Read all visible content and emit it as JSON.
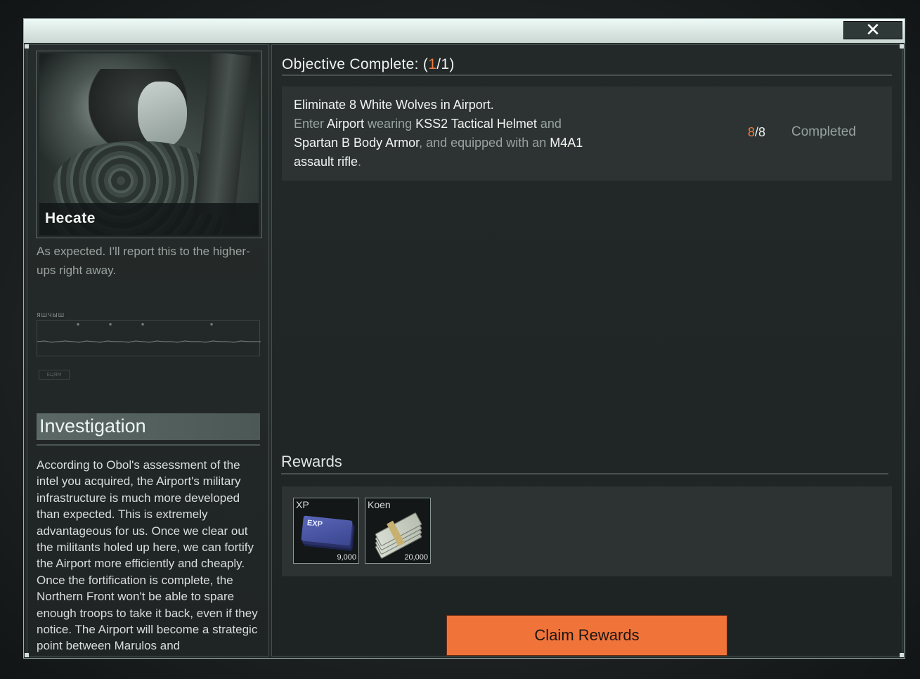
{
  "window": {
    "close_symbol": "✕"
  },
  "character": {
    "name": "Hecate",
    "quote": "As expected. I'll report this to the higher-ups right away."
  },
  "signal": {
    "label": "ЯШЧЫШ",
    "badge": "ЕЦЯМ"
  },
  "mission": {
    "title": "Investigation",
    "description": "According to Obol's assessment of the intel you acquired, the Airport's military infrastructure is much more developed than expected. This is extremely advantageous for us. Once we clear out the militants holed up here, we can fortify the Airport more efficiently and cheaply. Once the fortification is complete, the Northern Front won't be able to spare enough troops to take it back, even if they notice. The Airport will become a strategic point between Marulos and"
  },
  "objective": {
    "header_prefix": "Objective Complete: (",
    "header_done": "1",
    "header_suffix": "/1)",
    "line1_a": "Eliminate 8 ",
    "line1_b": "White Wolves",
    "line1_c": " in ",
    "line1_d": "Airport",
    "line1_e": ".",
    "line2_a": "Enter ",
    "line2_b": "Airport",
    "line2_c": " wearing ",
    "line2_d": "KSS2 Tactical Helmet",
    "line2_e": " and",
    "line3_a": "Spartan B Body Armor",
    "line3_b": ", and equipped with an ",
    "line3_c": "M4A1",
    "line4_a": "assault rifle",
    "line4_b": ".",
    "progress_current": "8",
    "progress_total": "/8",
    "status": "Completed"
  },
  "rewards": {
    "title": "Rewards",
    "items": [
      {
        "label": "XP",
        "quantity": "9,000",
        "icon": "exp-ticket-icon",
        "art_text": "EXP"
      },
      {
        "label": "Koen",
        "quantity": "20,000",
        "icon": "cash-stack-icon"
      }
    ],
    "claim_label": "Claim Rewards"
  },
  "colors": {
    "accent_orange": "#f07a3e",
    "button_orange": "#f0743a",
    "titlebar": "#eefaf6"
  }
}
